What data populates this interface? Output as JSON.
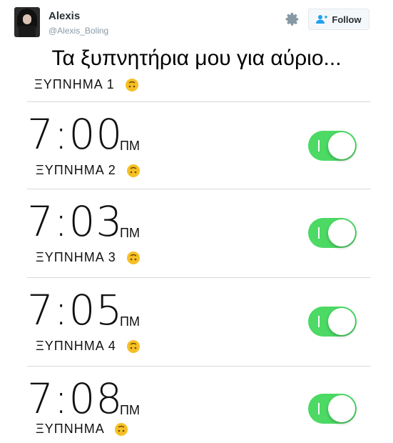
{
  "tweet": {
    "name": "Alexis",
    "handle": "@Alexis_Boling",
    "follow_label": "Follow"
  },
  "caption": "Τα ξυπνητήρια μου για αύριο...",
  "alarms": [
    {
      "label": "ΞΥΠΝΗΜΑ 1"
    },
    {
      "time": "7:00",
      "ampm": "ΠΜ",
      "label": "ΞΥΠΝΗΜΑ 2",
      "on": true
    },
    {
      "time": "7:03",
      "ampm": "ΠΜ",
      "label": "ΞΥΠΝΗΜΑ 3",
      "on": true
    },
    {
      "time": "7:05",
      "ampm": "ΠΜ",
      "label": "ΞΥΠΝΗΜΑ 4",
      "on": true
    },
    {
      "time": "7:08",
      "ampm": "ΠΜ",
      "label": "ΞΥΠΝΗΜΑ",
      "on": true
    }
  ],
  "colors": {
    "toggle_on": "#4cd964",
    "emoji": "#f5c026"
  },
  "icons": {
    "settings": "gear-icon",
    "follow": "add-user-icon",
    "emoji": "upside-down-face-icon"
  }
}
